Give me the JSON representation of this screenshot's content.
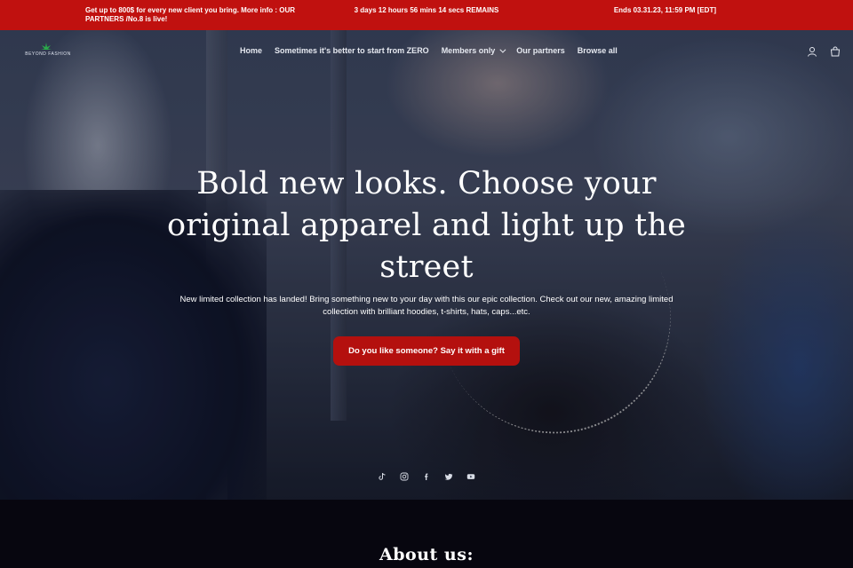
{
  "announcement": {
    "left": "Get up to 800$ for every new client you bring. More info : OUR PARTNERS /No.8 is live!",
    "center": "3 days 12 hours 56 mins 14 secs REMAINS",
    "right": "Ends 03.31.23, 11:59 PM [EDT]",
    "bg_color": "#c0110f"
  },
  "header": {
    "logo_text": "BEYOND FASHION",
    "nav": [
      {
        "label": "Home"
      },
      {
        "label": "Sometimes it's better to start from ZERO"
      },
      {
        "label": "Members only",
        "has_dropdown": true
      },
      {
        "label": "Our partners"
      },
      {
        "label": "Browse all"
      }
    ],
    "icons": [
      "account-icon",
      "cart-icon"
    ]
  },
  "hero": {
    "title": "Bold new looks. Choose your original apparel and light up the street",
    "description": "New limited collection has landed! Bring something new to your day with this our epic collection. Check out our new, amazing limited collection with brilliant hoodies, t-shirts, hats, caps...etc.",
    "cta_label": "Do you like someone? Say it with a gift",
    "cta_color": "#b4100e",
    "social_icons": [
      "tiktok-icon",
      "instagram-icon",
      "facebook-icon",
      "twitter-icon",
      "youtube-icon"
    ]
  },
  "about": {
    "title": "About us:"
  }
}
